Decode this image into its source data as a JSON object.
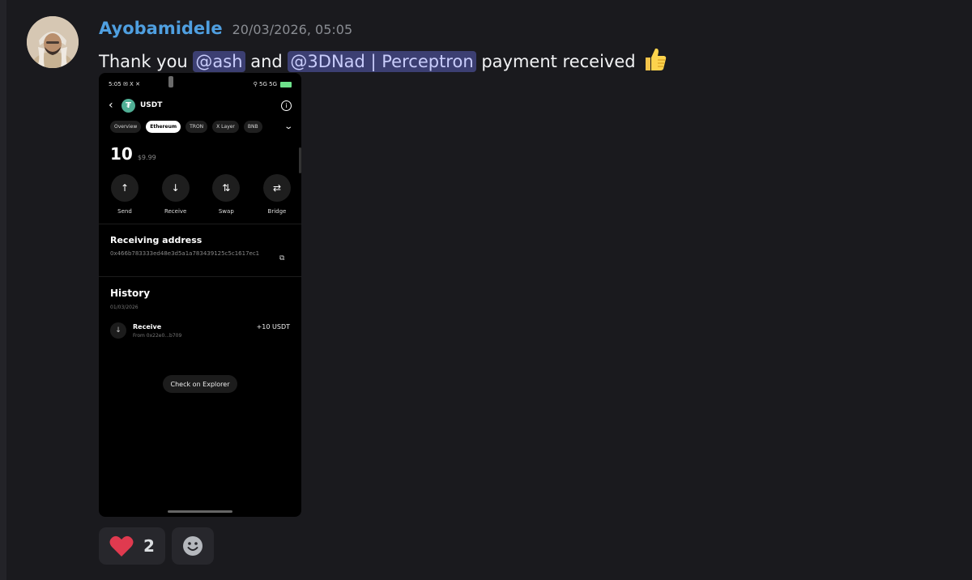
{
  "message": {
    "author": "Ayobamidele",
    "timestamp": "20/03/2026, 05:05",
    "content": {
      "prefix": "Thank you ",
      "mention1": "@ash",
      "middle": " and ",
      "mention2": "@3DNad | Perceptron",
      "suffix": " payment received",
      "emoji": "thumbs-up"
    },
    "reactions": [
      {
        "emoji": "heart",
        "count": "2"
      },
      {
        "emoji": "add-reaction",
        "count": ""
      }
    ]
  },
  "attachment": {
    "status_time": "5:05",
    "status_icons_left": "✉ X ✕",
    "status_icons_right": "⚲ 5G 5G",
    "token": "USDT",
    "chips": [
      "Overview",
      "Ethereum",
      "TRON",
      "X Layer",
      "BNB"
    ],
    "active_chip": "Ethereum",
    "balance_amount": "10",
    "balance_fiat": "$9.99",
    "actions": [
      "Send",
      "Receive",
      "Swap",
      "Bridge"
    ],
    "receiving_title": "Receiving address",
    "receiving_address": "0x466b783333ed48e3d5a1a783439125c5c1617ec1",
    "history_title": "History",
    "history_date": "01/03/2026",
    "tx": {
      "name": "Receive",
      "from": "From 0x22e0...b709",
      "amount": "+10 USDT"
    },
    "explorer_button": "Check on Explorer"
  },
  "colors": {
    "background": "#1a1a1e",
    "author": "#4f9fe0",
    "mention_bg": "#3c3f72",
    "mention_text": "#c9cdfb",
    "heart": "#e03a4f",
    "tether": "#50af95"
  }
}
